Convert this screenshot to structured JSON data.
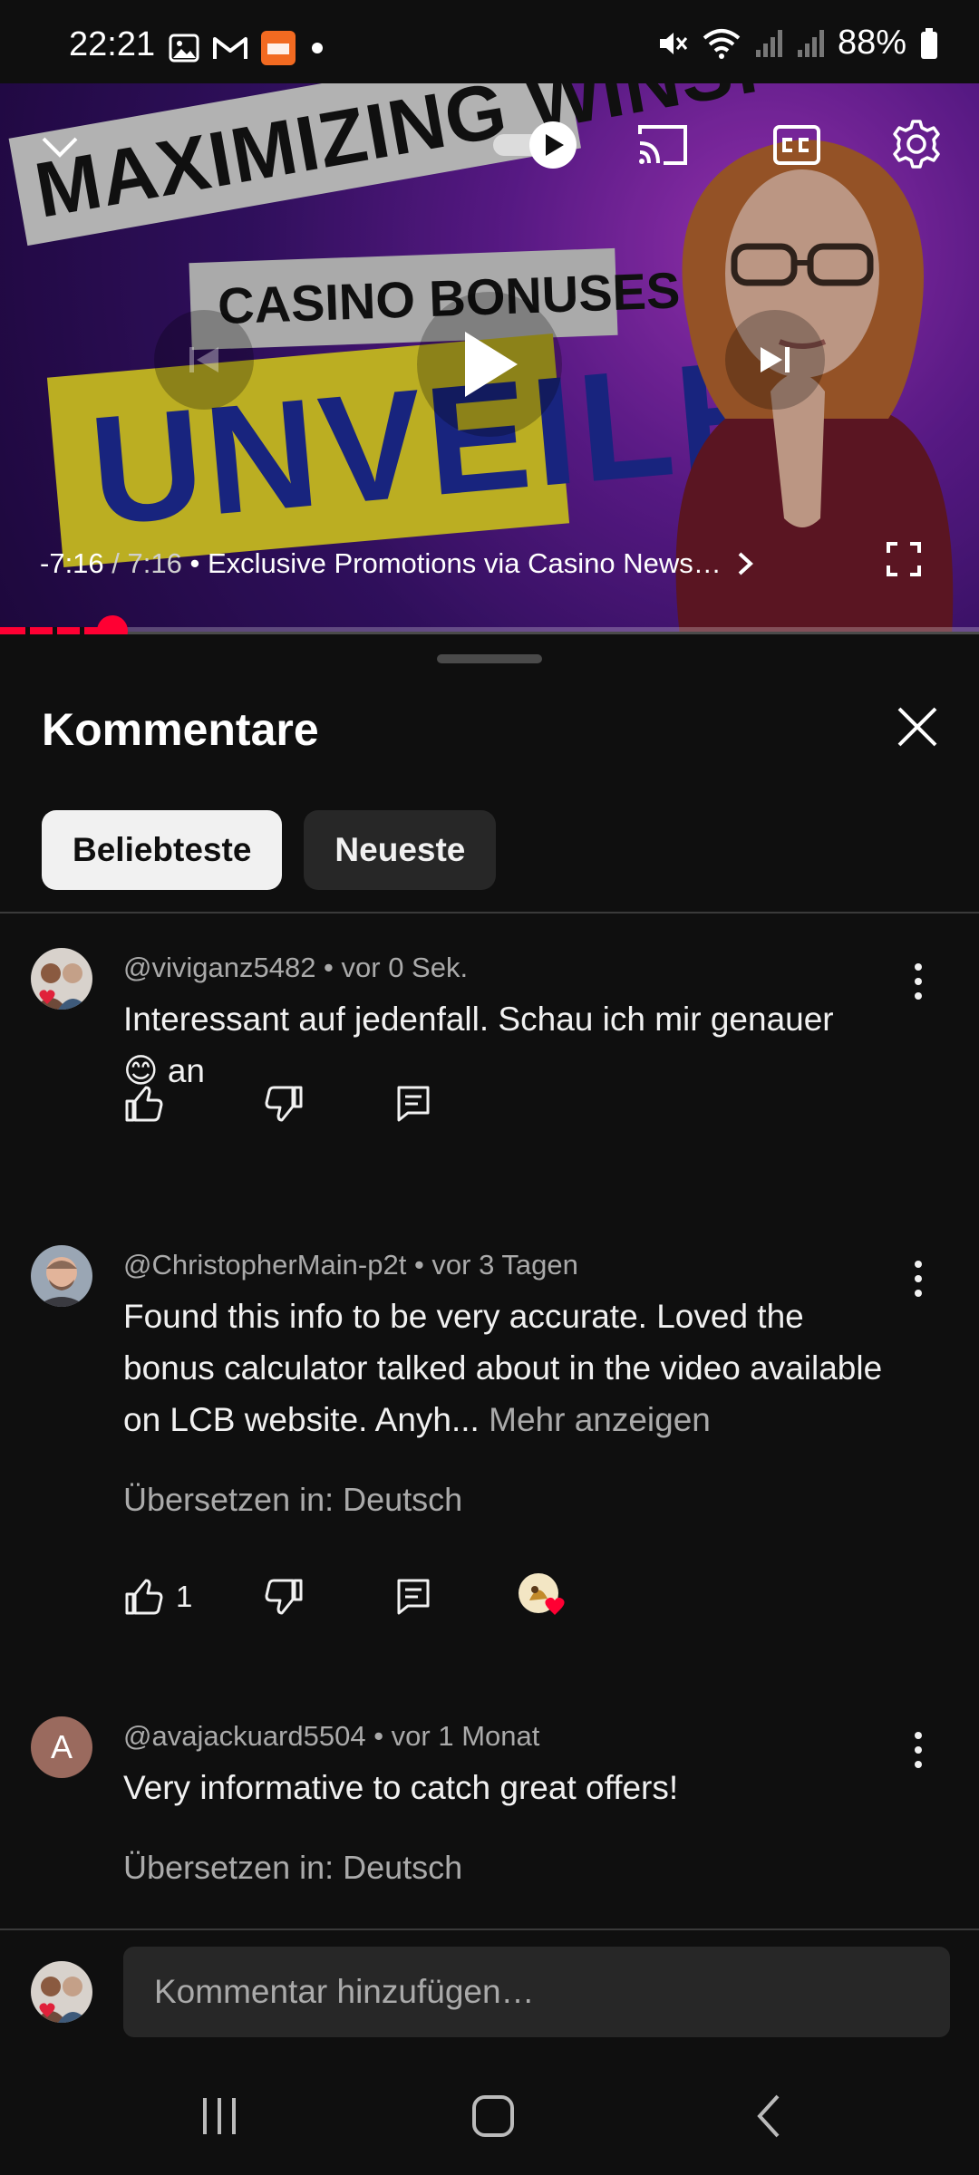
{
  "status_bar": {
    "time": "22:21",
    "battery": "88%",
    "notification_icons": [
      "gallery-icon",
      "gmail-icon",
      "temu-icon",
      "dot-icon"
    ],
    "system_icons": [
      "mute-icon",
      "wifi-icon",
      "signal-icon",
      "signal-icon",
      "battery-icon"
    ]
  },
  "player": {
    "thumbnail_text": {
      "line1": "MAXIMIZING WINS:",
      "line2": "CASINO BONUSES",
      "line3": "UNVEILED"
    },
    "time_remaining": "-7:16",
    "time_separator": " / ",
    "duration": "7:16",
    "chapter": " • Exclusive Promotions via Casino News…",
    "progress_fraction": 0.115,
    "colors": {
      "progress": "#ff0033"
    }
  },
  "comments_panel": {
    "title": "Kommentare",
    "chips": [
      "Beliebteste",
      "Neueste"
    ],
    "comments": [
      {
        "author": "@viviganz5482",
        "age": " • vor 0 Sek.",
        "text_part1": "Interessant auf jedenfall. Schau ich mir genauer",
        "emoji": "😊",
        "text_part2": " an"
      },
      {
        "author": "@ChristopherMain-p2t",
        "age": " • vor 3 Tagen",
        "text": "Found this info to be very accurate. Loved the bonus calculator talked about in the video available on LCB website. Anyh... ",
        "more": "Mehr anzeigen",
        "translate": "Übersetzen in: Deutsch",
        "likes": "1"
      },
      {
        "author": "@avajackuard5504",
        "age": " • vor 1 Monat",
        "avatar_letter": "A",
        "text": "Very informative to catch great offers!",
        "translate": "Übersetzen in: Deutsch"
      }
    ],
    "composer_placeholder": "Kommentar hinzufügen…"
  }
}
